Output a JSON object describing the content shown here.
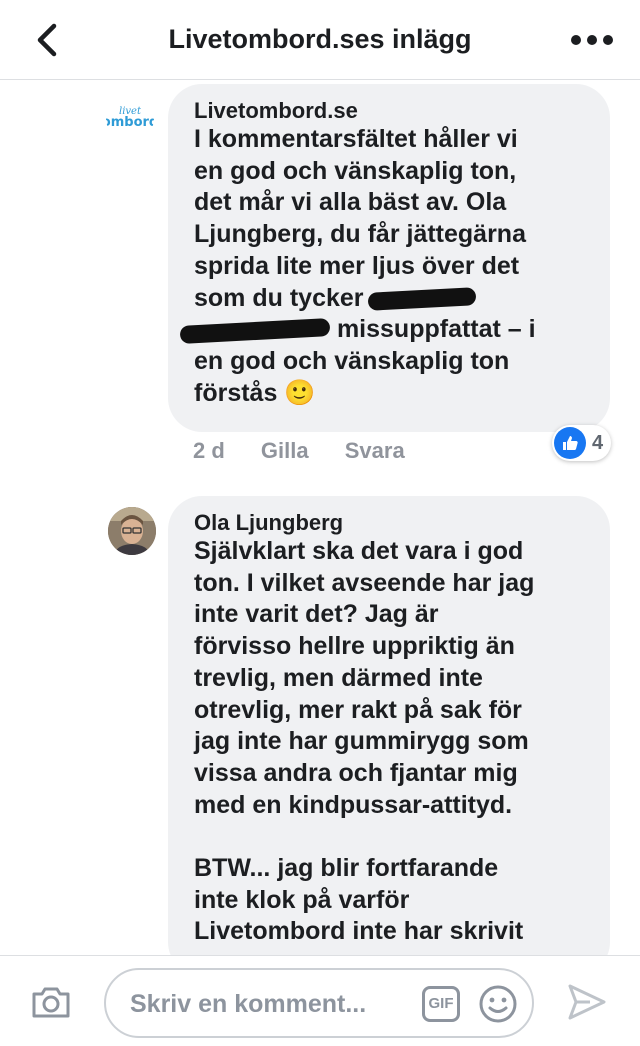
{
  "header": {
    "title": "Livetombord.ses inlägg"
  },
  "comments": [
    {
      "author": "Livetombord.se",
      "avatar_logo": {
        "line1": "livet",
        "line2": "ombord"
      },
      "text_a": "I kommentarsfältet håller vi\nen god och vänskaplig ton,\ndet mår vi alla bäst av. ",
      "mention": "Ola\nLjungberg",
      "text_b": ", du får jättegärna\nsprida lite mer ljus över det\nsom du tycker",
      "text_c": " missuppfattat – i\nen god och vänskaplig ton\nförstås ",
      "emoji": "🙂",
      "time": "2 d",
      "like_label": "Gilla",
      "reply_label": "Svara",
      "reaction_count": "4"
    },
    {
      "author": "Ola Ljungberg",
      "text": "Självklart ska det vara i god\nton. I vilket avseende har jag\ninte varit det? Jag är\nförvisso hellre uppriktig än\ntrevlig, men därmed inte\notrevlig, mer rakt på sak för\njag inte har gummirygg som\nvissa andra och fjantar mig\nmed en kindpussar-attityd.\n\nBTW... jag blir fortfarande\ninte klok på varför\nLivetombord inte har skrivit"
    }
  ],
  "composer": {
    "placeholder": "Skriv en komment...",
    "gif_label": "GIF"
  },
  "colors": {
    "like_blue": "#1877f2",
    "bubble_gray": "#f0f1f3",
    "logo_blue": "#2e9bd6"
  }
}
